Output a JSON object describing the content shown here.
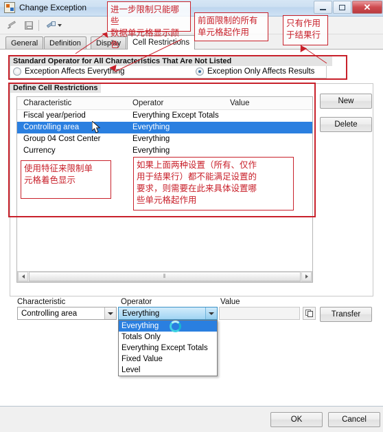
{
  "window": {
    "title": "Change Exception",
    "icon": "app-icon",
    "controls": {
      "minimize": "–",
      "maximize": "❐",
      "close": "✕"
    }
  },
  "toolbar": {
    "items": [
      {
        "name": "edit-pencil-icon",
        "label": ""
      },
      {
        "name": "save-icon",
        "label": ""
      },
      {
        "name": "settings-wrench-icon",
        "label": ""
      }
    ]
  },
  "tabs": [
    {
      "label": "General",
      "active": false
    },
    {
      "label": "Definition",
      "active": false
    },
    {
      "label": "Display",
      "active": false
    },
    {
      "label": "Cell Restrictions",
      "active": true
    }
  ],
  "standard_operator": {
    "title": "Standard Operator for All Characteristics That Are Not Listed",
    "options": [
      {
        "label": "Exception Affects Everything",
        "selected": false
      },
      {
        "label": "Exception Only Affects Results",
        "selected": true
      }
    ]
  },
  "define_cell_restrictions": {
    "title": "Define Cell Restrictions",
    "columns": [
      "Characteristic",
      "Operator",
      "Value"
    ],
    "rows": [
      {
        "characteristic": "Fiscal year/period",
        "operator": "Everything Except Totals",
        "value": "",
        "selected": false
      },
      {
        "characteristic": "Controlling area",
        "operator": "Everything",
        "value": "",
        "selected": true
      },
      {
        "characteristic": "Group 04 Cost Center",
        "operator": "Everything",
        "value": "",
        "selected": false
      },
      {
        "characteristic": "Currency",
        "operator": "Everything",
        "value": "",
        "selected": false
      }
    ],
    "buttons": {
      "new": "New",
      "delete": "Delete"
    },
    "scrollbar_grip": "⦀"
  },
  "editor": {
    "labels": {
      "characteristic": "Characteristic",
      "operator": "Operator",
      "value": "Value"
    },
    "characteristic_value": "Controlling area",
    "operator_value": "Everything",
    "value_value": "",
    "operator_options": [
      {
        "label": "Everything",
        "selected": true
      },
      {
        "label": "Totals Only",
        "selected": false
      },
      {
        "label": "Everything Except Totals",
        "selected": false
      },
      {
        "label": "Fixed Value",
        "selected": false
      },
      {
        "label": "Level",
        "selected": false
      }
    ],
    "copy_icon": "copy-icon",
    "transfer_button": "Transfer"
  },
  "footer": {
    "ok": "OK",
    "cancel": "Cancel"
  },
  "annotations": [
    {
      "id": "anno-1",
      "text": "进一步限制只能哪些\n数据单元格显示颜色"
    },
    {
      "id": "anno-2",
      "text": "前面限制的所有\n单元格起作用"
    },
    {
      "id": "anno-3",
      "text": "只有作用\n于结果行"
    },
    {
      "id": "anno-4",
      "text": "使用特征来限制单\n元格着色显示"
    },
    {
      "id": "anno-5",
      "text": "如果上面两种设置（所有、仅作\n用于结果行）都不能满足设置的\n要求，则需要在此来具体设置哪\n些单元格起作用"
    }
  ],
  "colors": {
    "annotation": "#c8202a",
    "selection": "#2a7fe0",
    "titlebar": "#cde0f2",
    "close_button": "#cf4b4f"
  }
}
